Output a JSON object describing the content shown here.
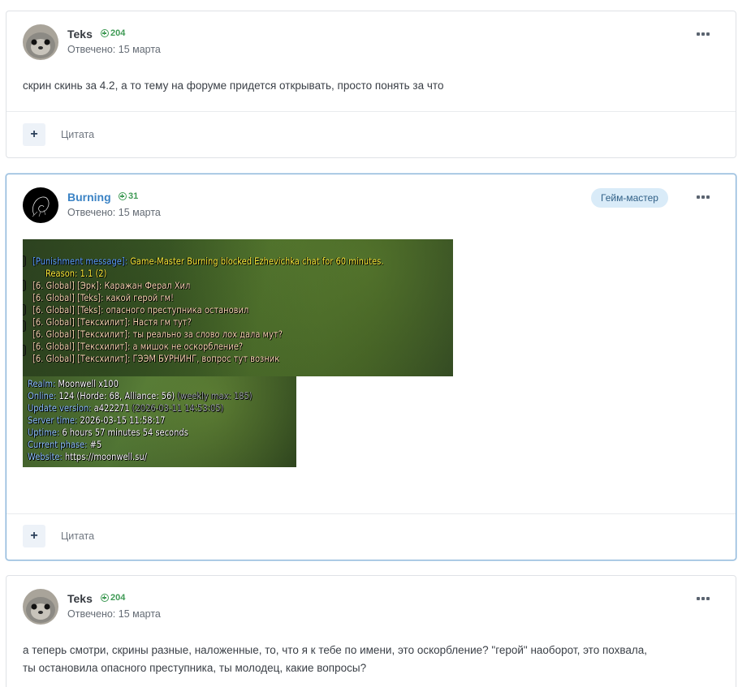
{
  "posts": [
    {
      "author": "Teks",
      "reputation": "204",
      "date": "Отвечено: 15 марта",
      "text": "скрин скинь за 4.2, а то тему на форуме придется открывать, просто понять за что",
      "quote_label": "Цитата"
    },
    {
      "author": "Burning",
      "reputation": "31",
      "date": "Отвечено: 15 марта",
      "badge": "Гейм-мастер",
      "quote_label": "Цитата",
      "screenshot": {
        "punish_label": "[Punishment message]:",
        "punish_text": "Game-Master Burning blocked Ezhevichka chat for 60 minutes.",
        "reason": "Reason: 1.1 (2)",
        "chat": [
          "[6. Global] [Эрк]: Каражан Ферал Хил",
          "[6. Global] [Teks]: какой герой гм!",
          "[6. Global] [Teks]: опасного преступника остановил",
          "[6. Global] [Тексхилит]: Настя гм тут?",
          "[6. Global] [Тексхилит]: ты реально за слово лох дала мут?",
          "[6. Global] [Тексхилит]: а мишок не оскорбление?",
          "[6. Global] [Тексхилит]: ГЭЭМ БУРНИНГ, вопрос тут возник"
        ],
        "info": {
          "realm_label": "Realm:",
          "realm_value": "Moonwell x100",
          "online_label": "Online:",
          "online_value": "124 (Horde: 68, Alliance: 56)",
          "online_extra": "(weekly max: 185)",
          "version_label": "Update version:",
          "version_value": "a422271",
          "version_extra": "(2026-03-11 14:53:05)",
          "time_label": "Server time:",
          "time_value": "2026-03-15 11:58:17",
          "uptime_label": "Uptime:",
          "uptime_value": "6 hours 57 minutes 54 seconds",
          "phase_label": "Current phase:",
          "phase_value": "#5",
          "website_label": "Website:",
          "website_value": "https://moonwell.su/"
        }
      }
    },
    {
      "author": "Teks",
      "reputation": "204",
      "date": "Отвечено: 15 марта",
      "text_line1": "а теперь смотри, скрины разные, наложенные, то, что я к тебе по имени, это оскорбление? \"герой\" наоборот, это похвала,",
      "text_line2": "ты остановила опасного преступника, ты молодец, какие вопросы?"
    }
  ]
}
